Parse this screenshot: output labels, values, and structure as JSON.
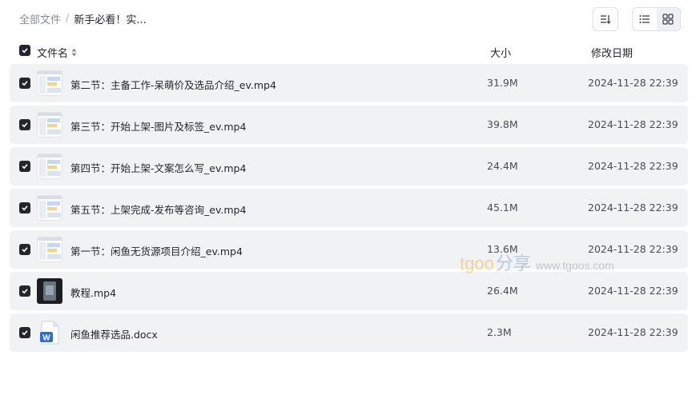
{
  "breadcrumb": {
    "root": "全部文件",
    "separator": "/",
    "current": "新手必看！实..."
  },
  "toolbar": {
    "sort_icon": "sort-icon",
    "list_view_icon": "list-view-icon",
    "grid_view_icon": "grid-view-icon",
    "active_view": "grid"
  },
  "columns": {
    "name": "文件名",
    "size": "大小",
    "modified": "修改日期"
  },
  "files": [
    {
      "name": "第二节：主备工作-呆萌价及选品介绍_ev.mp4",
      "size": "31.9M",
      "date": "2024-11-28 22:39",
      "thumb": "video-screenshot",
      "checked": true
    },
    {
      "name": "第三节：开始上架-图片及标签_ev.mp4",
      "size": "39.8M",
      "date": "2024-11-28 22:39",
      "thumb": "video-screenshot",
      "checked": true
    },
    {
      "name": "第四节：开始上架-文案怎么写_ev.mp4",
      "size": "24.4M",
      "date": "2024-11-28 22:39",
      "thumb": "video-screenshot",
      "checked": true
    },
    {
      "name": "第五节：上架完成-发布等咨询_ev.mp4",
      "size": "45.1M",
      "date": "2024-11-28 22:39",
      "thumb": "video-screenshot",
      "checked": true
    },
    {
      "name": "第一节：闲鱼无货源项目介绍_ev.mp4",
      "size": "13.6M",
      "date": "2024-11-28 22:39",
      "thumb": "video-screenshot",
      "checked": true
    },
    {
      "name": "教程.mp4",
      "size": "26.4M",
      "date": "2024-11-28 22:39",
      "thumb": "video-dark",
      "checked": true
    },
    {
      "name": "闲鱼推荐选品.docx",
      "size": "2.3M",
      "date": "2024-11-28 22:39",
      "thumb": "word-doc",
      "checked": true
    }
  ],
  "watermark": {
    "logo": "tgoo",
    "share": "分享",
    "site": "www.tgoos.com"
  },
  "colors": {
    "row_bg": "#f1f2f4",
    "checkbox": "#25262b",
    "word_blue": "#2b6fd6"
  }
}
